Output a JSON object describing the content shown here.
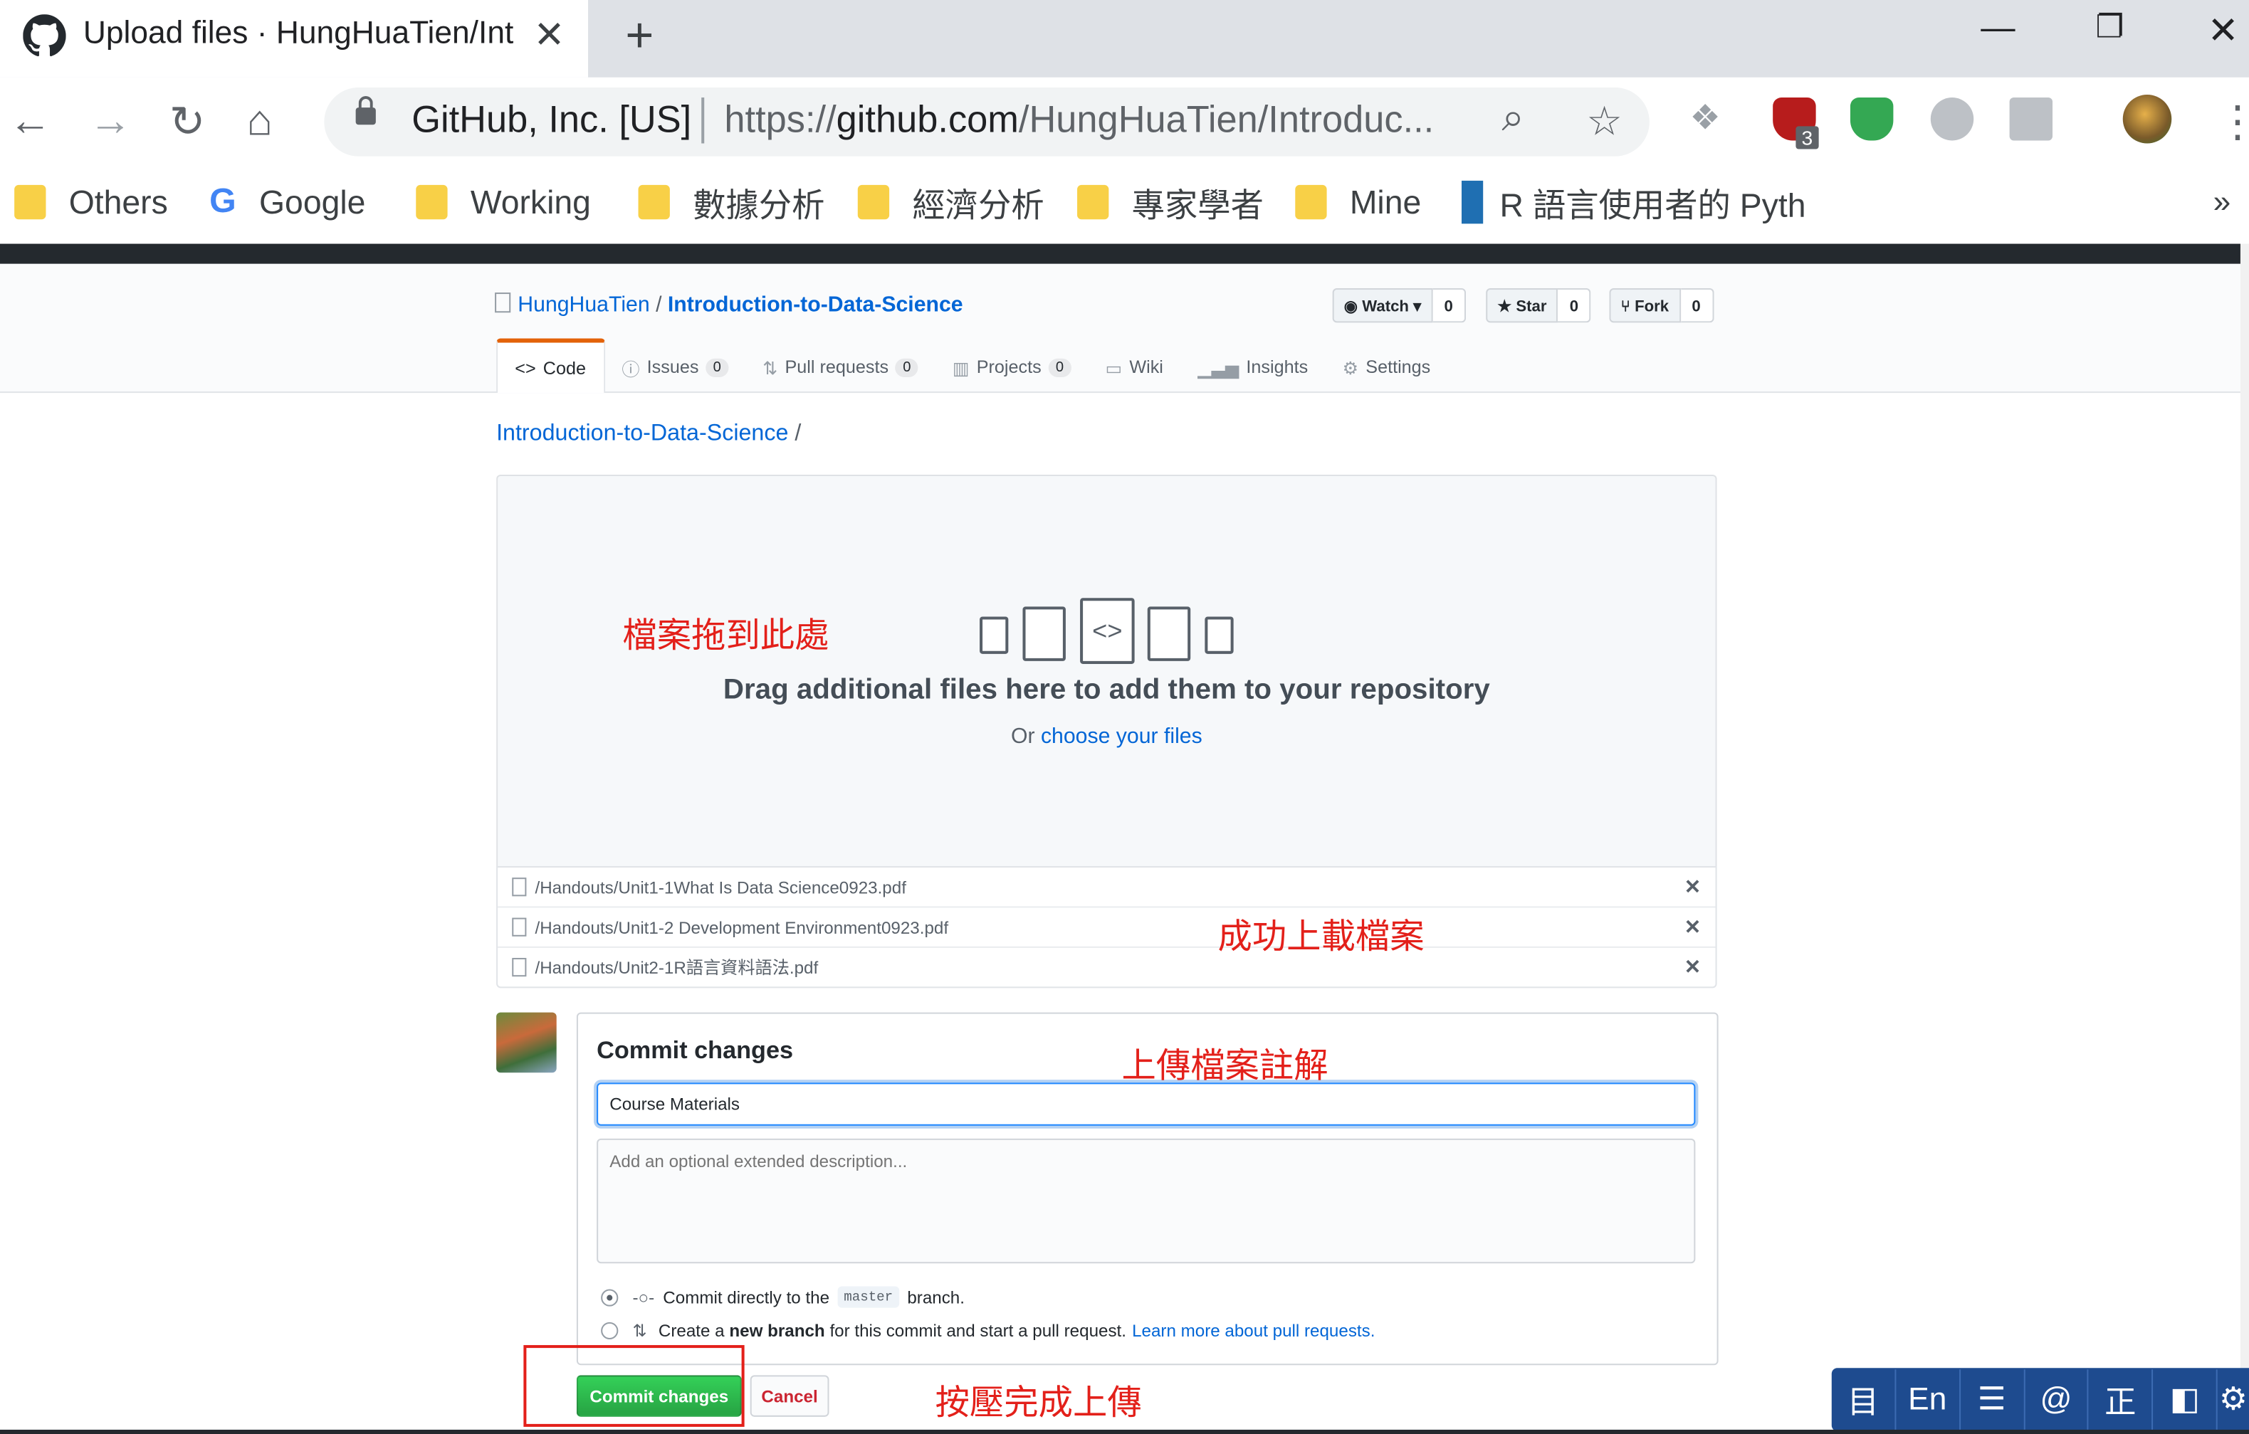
{
  "browser": {
    "tab_title": "Upload files · HungHuaTien/Int",
    "site_identity": "GitHub, Inc. [US]",
    "url_scheme": "https://",
    "url_host": "github.com",
    "url_path": "/HungHuaTien/Introduc...",
    "extension_badge": "3",
    "bookmarks": [
      "Others",
      "Google",
      "Working",
      "數據分析",
      "經濟分析",
      "專家學者",
      "Mine",
      "R 語言使用者的 Pyth"
    ]
  },
  "repo": {
    "owner": "HungHuaTien",
    "separator": "/",
    "name": "Introduction-to-Data-Science",
    "watch_label": "Watch",
    "watch_count": "0",
    "star_label": "Star",
    "star_count": "0",
    "fork_label": "Fork",
    "fork_count": "0",
    "tabs": [
      {
        "label": "Code",
        "counter": ""
      },
      {
        "label": "Issues",
        "counter": "0"
      },
      {
        "label": "Pull requests",
        "counter": "0"
      },
      {
        "label": "Projects",
        "counter": "0"
      },
      {
        "label": "Wiki",
        "counter": ""
      },
      {
        "label": "Insights",
        "counter": ""
      },
      {
        "label": "Settings",
        "counter": ""
      }
    ]
  },
  "upload": {
    "breadcrumb_repo": "Introduction-to-Data-Science",
    "breadcrumb_sep": "/",
    "drop_text": "Drag additional files here to add them to your repository",
    "or_text": "Or",
    "choose_link": "choose your files",
    "files": [
      "/Handouts/Unit1-1What Is Data Science0923.pdf",
      "/Handouts/Unit1-2 Development Environment0923.pdf",
      "/Handouts/Unit2-1R語言資料語法.pdf"
    ]
  },
  "commit": {
    "title": "Commit changes",
    "message_value": "Course Materials",
    "description_placeholder": "Add an optional extended description...",
    "option1_prefix": "Commit directly to the",
    "option1_branch": "master",
    "option1_suffix": "branch.",
    "option2_prefix": "Create a",
    "option2_bold": "new branch",
    "option2_suffix": "for this commit and start a pull request.",
    "option2_link": "Learn more about pull requests.",
    "commit_button": "Commit changes",
    "cancel_button": "Cancel"
  },
  "annotations": {
    "drop_here": "檔案拖到此處",
    "uploaded": "成功上載檔案",
    "comment": "上傳檔案註解",
    "press": "按壓完成上傳"
  },
  "ime": [
    "目",
    "En",
    "☰",
    "@",
    "正",
    "◧",
    "⚙"
  ]
}
